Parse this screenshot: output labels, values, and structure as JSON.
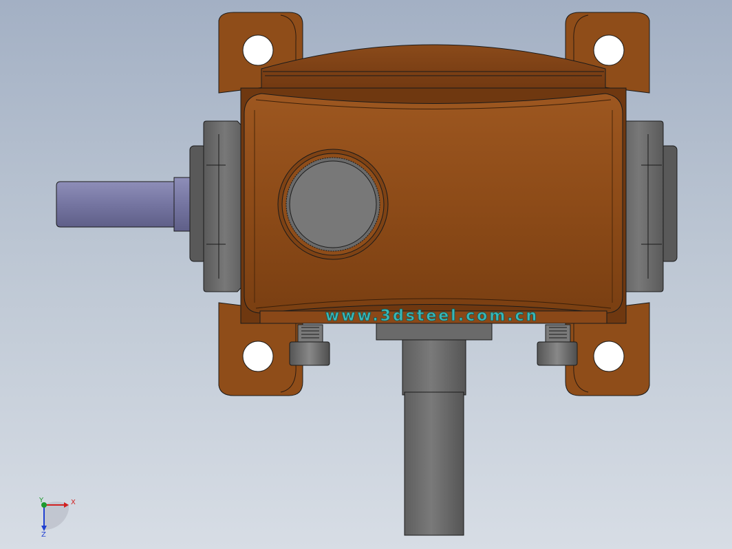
{
  "viewport": {
    "background_top": "#a3b0c4",
    "background_bottom": "#d7dde5"
  },
  "model": {
    "housing_color": "#8b4a16",
    "housing_highlight": "#a9602a",
    "shaft_input_color": "#7a7aa6",
    "shaft_output_color": "#6d6d6d",
    "bearing_cap_color": "#6b6b6b",
    "engraving_color": "#3bb7b7",
    "engraving_text": "www.3dsteel.com.cn"
  },
  "triad": {
    "x_label": "X",
    "y_label": "Y",
    "z_label": "Z",
    "x_color": "#d12020",
    "y_color": "#1e9a2e",
    "z_color": "#1f3fd1"
  }
}
